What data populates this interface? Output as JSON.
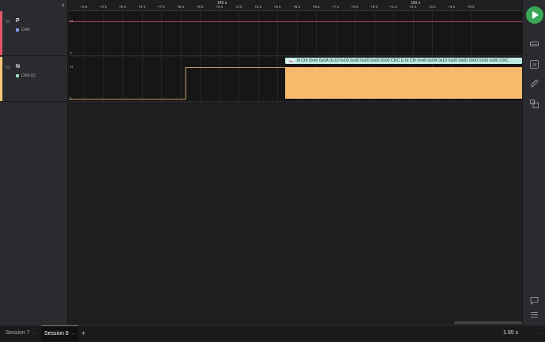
{
  "timeline": {
    "major_labels": [
      "140 s",
      "150 s"
    ],
    "tick_labels": [
      "+3 s",
      "+4 s",
      "+5 s",
      "+6 s",
      "+7 s",
      "+8 s",
      "+9 s",
      "+1 s",
      "+2 s",
      "+3 s",
      "+4 s",
      "+5 s",
      "+6 s",
      "+7 s",
      "+8 s",
      "+9 s",
      "+1 s",
      "+2 s",
      "+3 s",
      "+4 s",
      "+5 s"
    ]
  },
  "channels": [
    {
      "index": "02",
      "name": "P",
      "analyzer": "CAN",
      "color": "#e0556a",
      "analyzer_color": "#8aa0ff",
      "high_label": "H",
      "low_label": "L"
    },
    {
      "index": "03",
      "name": "N",
      "analyzer": "CAN [1]",
      "color": "#f5c57a",
      "analyzer_color": "#9ee6c9",
      "high_label": "H",
      "low_label": "L"
    }
  ],
  "frame": {
    "tag": "11b",
    "text": "Id Ctrl 0x40 0x0A 0x10 0x00 0x00 0x00 0x00 0x00 CRC E Id Ctrl 0x40 0x0A 0x10 0x00 0x00 0x00 0x00 0x00 CRC"
  },
  "colors": {
    "burst_fill": "#f7b96b",
    "ch_p_line": "#e0556a",
    "ch_n_line": "#f5c57a",
    "play_accent": "#3aa757"
  },
  "icons": [
    "collapse-chevron-icon",
    "play-icon",
    "device-icon",
    "sample-count-icon",
    "ruler-icon",
    "extensions-icon",
    "chat-icon",
    "menu-icon"
  ],
  "sample_badge": "16",
  "sessions": [
    {
      "label": "Session 7",
      "active": false
    },
    {
      "label": "Session 8",
      "active": true
    }
  ],
  "add_label": "+",
  "status": {
    "time": "1.95 s"
  }
}
